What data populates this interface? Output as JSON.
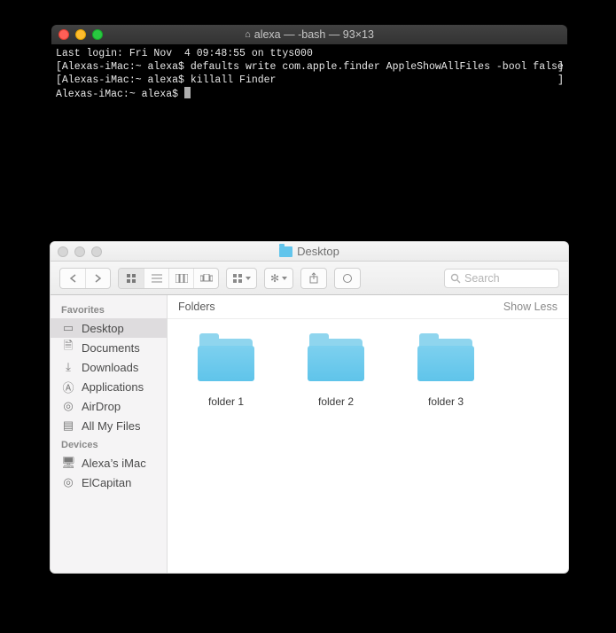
{
  "terminal": {
    "title": "alexa — -bash — 93×13",
    "lines": {
      "l0": "Last login: Fri Nov  4 09:48:55 on ttys000",
      "l1": "Alexas-iMac:~ alexa$ defaults write com.apple.finder AppleShowAllFiles -bool false",
      "l2": "Alexas-iMac:~ alexa$ killall Finder",
      "l3": "Alexas-iMac:~ alexa$ "
    }
  },
  "finder": {
    "title": "Desktop",
    "search_placeholder": "Search",
    "section_title": "Folders",
    "section_action": "Show Less",
    "sidebar": {
      "favorites_label": "Favorites",
      "devices_label": "Devices",
      "desktop": "Desktop",
      "documents": "Documents",
      "downloads": "Downloads",
      "applications": "Applications",
      "airdrop": "AirDrop",
      "allmyfiles": "All My Files",
      "imac": "Alexa’s iMac",
      "elcapitan": "ElCapitan"
    },
    "items": [
      "folder 1",
      "folder 2",
      "folder 3"
    ]
  }
}
